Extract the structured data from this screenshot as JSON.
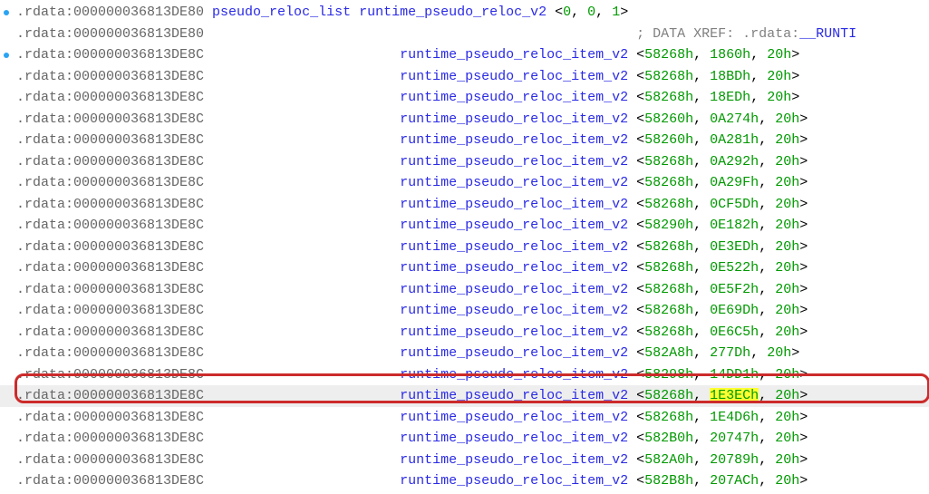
{
  "header": {
    "seg": ".rdata:000000036813DE80",
    "type": "pseudo_reloc_list runtime_pseudo_reloc_v2",
    "vals": [
      "0",
      "0",
      "1"
    ]
  },
  "xref_row": {
    "seg": ".rdata:000000036813DE80",
    "comment": "; DATA XREF: .rdata:__RUNTI"
  },
  "item_type": "runtime_pseudo_reloc_item_v2",
  "rows": [
    {
      "seg": ".rdata:000000036813DE8C",
      "v": [
        "58268h",
        "1860h",
        "20h"
      ],
      "bp": true
    },
    {
      "seg": ".rdata:000000036813DE8C",
      "v": [
        "58268h",
        "18BDh",
        "20h"
      ]
    },
    {
      "seg": ".rdata:000000036813DE8C",
      "v": [
        "58268h",
        "18EDh",
        "20h"
      ]
    },
    {
      "seg": ".rdata:000000036813DE8C",
      "v": [
        "58260h",
        "0A274h",
        "20h"
      ]
    },
    {
      "seg": ".rdata:000000036813DE8C",
      "v": [
        "58260h",
        "0A281h",
        "20h"
      ]
    },
    {
      "seg": ".rdata:000000036813DE8C",
      "v": [
        "58268h",
        "0A292h",
        "20h"
      ]
    },
    {
      "seg": ".rdata:000000036813DE8C",
      "v": [
        "58268h",
        "0A29Fh",
        "20h"
      ]
    },
    {
      "seg": ".rdata:000000036813DE8C",
      "v": [
        "58268h",
        "0CF5Dh",
        "20h"
      ]
    },
    {
      "seg": ".rdata:000000036813DE8C",
      "v": [
        "58290h",
        "0E182h",
        "20h"
      ]
    },
    {
      "seg": ".rdata:000000036813DE8C",
      "v": [
        "58268h",
        "0E3EDh",
        "20h"
      ]
    },
    {
      "seg": ".rdata:000000036813DE8C",
      "v": [
        "58268h",
        "0E522h",
        "20h"
      ]
    },
    {
      "seg": ".rdata:000000036813DE8C",
      "v": [
        "58268h",
        "0E5F2h",
        "20h"
      ]
    },
    {
      "seg": ".rdata:000000036813DE8C",
      "v": [
        "58268h",
        "0E69Dh",
        "20h"
      ]
    },
    {
      "seg": ".rdata:000000036813DE8C",
      "v": [
        "58268h",
        "0E6C5h",
        "20h"
      ]
    },
    {
      "seg": ".rdata:000000036813DE8C",
      "v": [
        "582A8h",
        "277Dh",
        "20h"
      ]
    },
    {
      "seg": ".rdata:000000036813DE8C",
      "v": [
        "58298h",
        "14DD1h",
        "20h"
      ]
    },
    {
      "seg": ".rdata:000000036813DE8C",
      "v": [
        "58268h",
        "1E3ECh",
        "20h"
      ],
      "sel": true,
      "hl": 1
    },
    {
      "seg": ".rdata:000000036813DE8C",
      "v": [
        "58268h",
        "1E4D6h",
        "20h"
      ]
    },
    {
      "seg": ".rdata:000000036813DE8C",
      "v": [
        "582B0h",
        "20747h",
        "20h"
      ]
    },
    {
      "seg": ".rdata:000000036813DE8C",
      "v": [
        "582A0h",
        "20789h",
        "20h"
      ]
    },
    {
      "seg": ".rdata:000000036813DE8C",
      "v": [
        "582B8h",
        "207ACh",
        "20h"
      ]
    }
  ],
  "bp_header": true,
  "indent_type_col": 47
}
